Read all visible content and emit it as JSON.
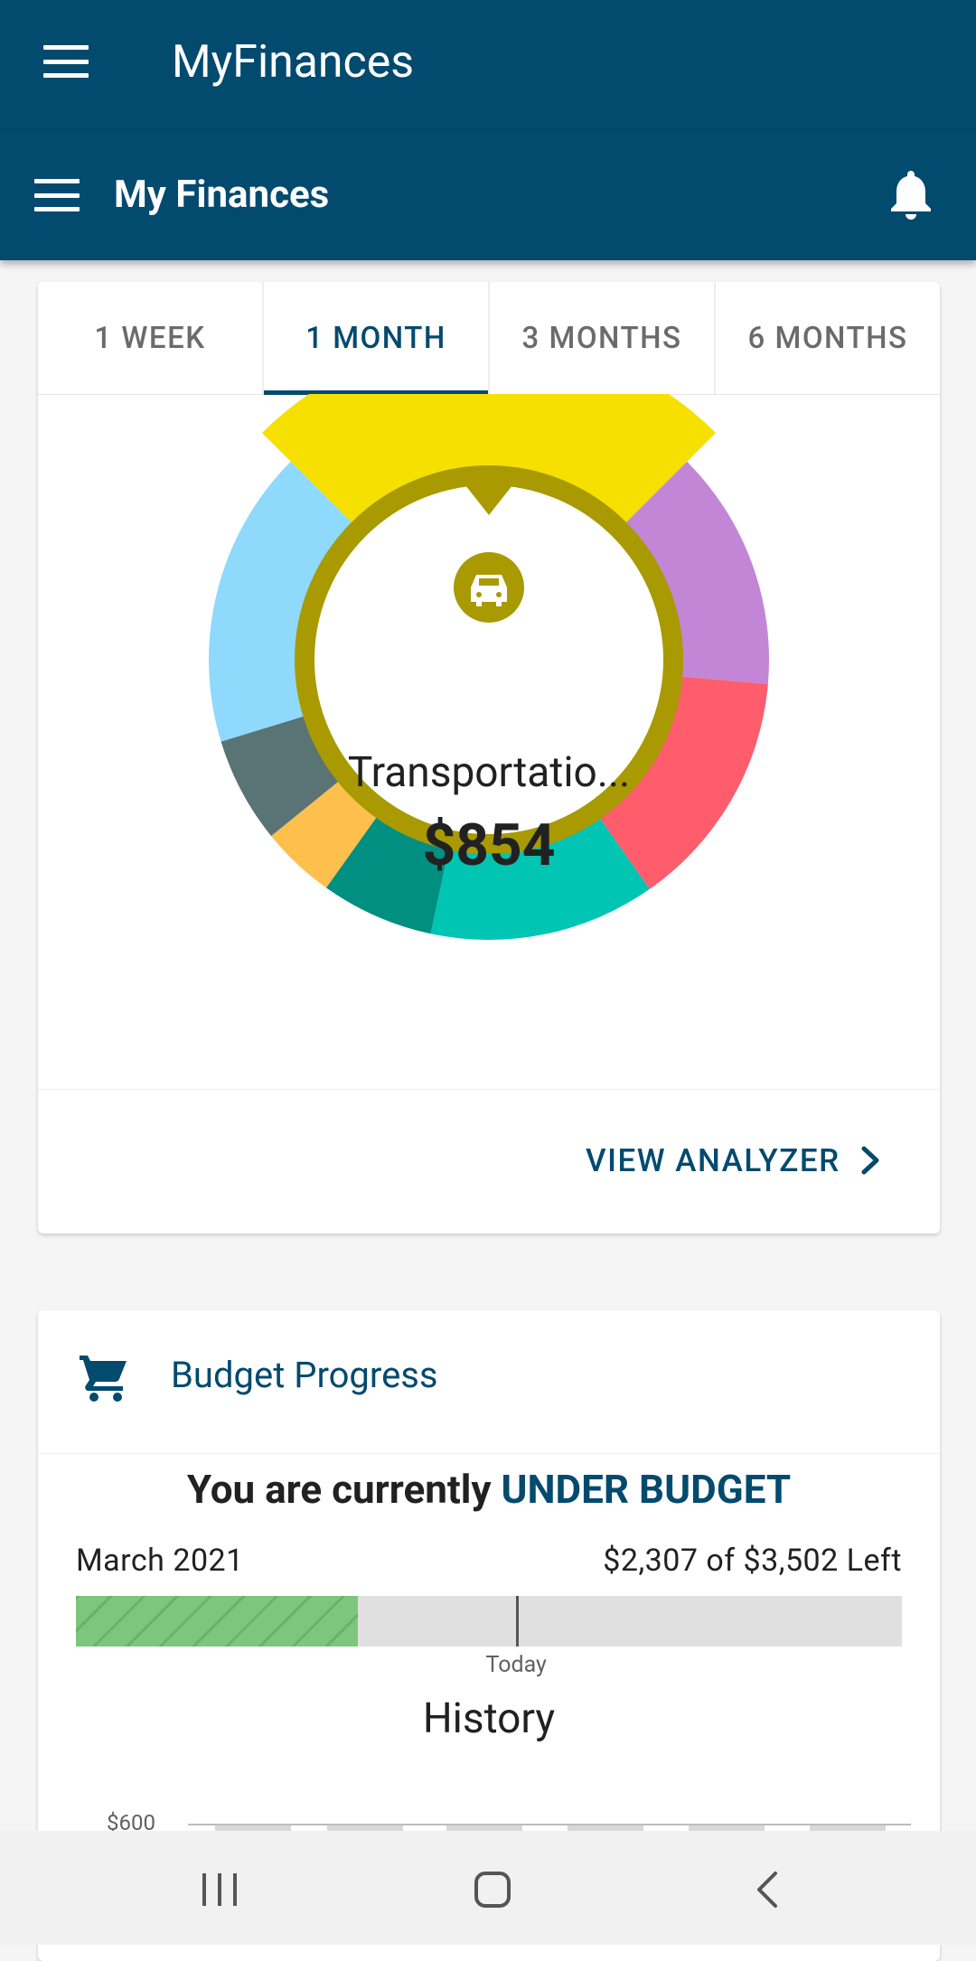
{
  "app": {
    "window_title": "MyFinances",
    "header_title": "My Finances"
  },
  "tabs": [
    {
      "label": "1 WEEK",
      "active": false
    },
    {
      "label": "1 MONTH",
      "active": true
    },
    {
      "label": "3 MONTHS",
      "active": false
    },
    {
      "label": "6 MONTHS",
      "active": false
    }
  ],
  "spending_chart": {
    "selected_category": "Transportatio...",
    "selected_amount": "$854",
    "selected_icon": "car-icon",
    "selected_color": "#f5e000",
    "ring_color": "#a89a00",
    "segments": [
      {
        "color": "#f5e000",
        "selected": true
      },
      {
        "color": "#c386d6"
      },
      {
        "color": "#ff5c6c"
      },
      {
        "color": "#00c5b3"
      },
      {
        "color": "#008f80"
      },
      {
        "color": "#ffbf4d"
      },
      {
        "color": "#5a7375"
      },
      {
        "color": "#8fd9fc"
      }
    ]
  },
  "view_analyzer_label": "VIEW ANALYZER",
  "budget": {
    "title": "Budget Progress",
    "status_prefix": "You are currently ",
    "status_value": "UNDER BUDGET",
    "month": "March 2021",
    "left_text": "$2,307 of $3,502 Left",
    "spent_fraction": 0.341,
    "today_fraction": 0.533,
    "today_label": "Today",
    "history_title": "History",
    "history_y_tick": "$600"
  },
  "colors": {
    "primary": "#034a6f",
    "progress": "#7dc77d"
  },
  "icons": {
    "menu": "hamburger-menu-icon",
    "notifications": "bell-icon",
    "cart": "shopping-cart-icon",
    "chevron": "chevron-right-icon"
  }
}
